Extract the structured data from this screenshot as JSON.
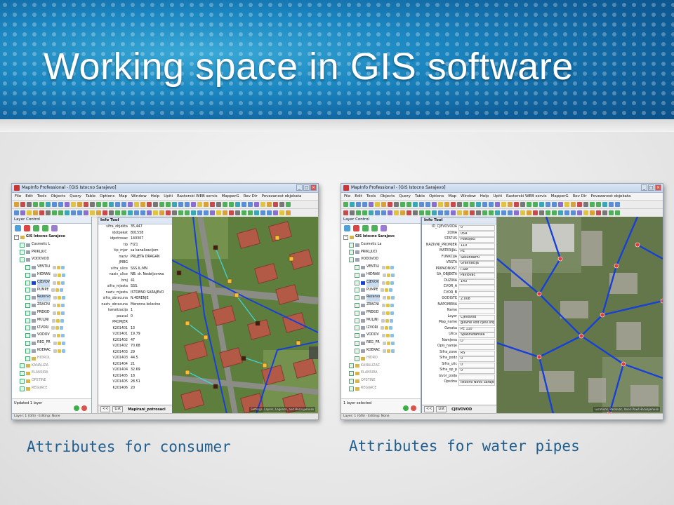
{
  "slide": {
    "title": "Working space in GIS software",
    "captions": {
      "left": "Attributes for consumer",
      "right": "Attributes for water pipes"
    }
  },
  "app": {
    "window_title": "MapInfo Professional - [GIS Istocno Sarajevo]",
    "menus": [
      "File",
      "Edit",
      "Tools",
      "Objects",
      "Query",
      "Table",
      "Options",
      "Map",
      "Window",
      "Help",
      "Upiti",
      "Rasterski WEB servis",
      "MapperG",
      "Rev Dir",
      "Povezanost objekata"
    ]
  },
  "layer_control": {
    "title": "Layer Control",
    "root": "GIS Istocno Sarajevo",
    "layers_left": [
      "Cosmetic L",
      "PRIKLJUC",
      "VODOVOD",
      "VENTILI",
      "HIDRAN",
      "CJEVOV",
      "PUMPE",
      "Rezervo",
      "ZRACNI",
      "PREKID",
      "MULJNI",
      "IZVORI",
      "VODOV",
      "REG_PR",
      "KOERAC",
      "HIDROL",
      "KANALIZA",
      "ELANSIRA",
      "OPSTINE",
      "REGIJACE"
    ],
    "layers_right": [
      "Cosmetic La",
      "PRIKLJUCI",
      "VODOVOD",
      "VENTILI",
      "HIDRAN",
      "CJEVOV",
      "PUMPE",
      "Rezervo",
      "ZRACNI",
      "PREKID",
      "MULJNI",
      "IZVORI",
      "VODOV",
      "REG_PR",
      "KOERAC",
      "HIDRO",
      "KANALIZAC",
      "ELANSIRA",
      "OPSTINE",
      "REGIJACE"
    ],
    "status_left": "Updated 1 layer",
    "status_right": "1 layer selected"
  },
  "info_left": {
    "title": "Info Tool",
    "rows": [
      {
        "k": "sifra_objekta",
        "v": "35,447"
      },
      {
        "k": "idobjekat",
        "v": "801558"
      },
      {
        "k": "idpotrosac",
        "v": "140307"
      },
      {
        "k": "tip",
        "v": "FIZ1"
      },
      {
        "k": "tip_mjer",
        "v": "sa kanalizacijom"
      },
      {
        "k": "naziv",
        "v": "PRLJETA DRAGAN"
      },
      {
        "k": "JMBG",
        "v": ""
      },
      {
        "k": "sifra_ulice",
        "v": "SSS.IL.MN"
      },
      {
        "k": "naziv_ulice",
        "v": "NB. dr. Nedeljovrwa"
      },
      {
        "k": "broj",
        "v": "41"
      },
      {
        "k": "sifra_mjesta",
        "v": "SSS."
      },
      {
        "k": "naziv_mjesta",
        "v": "ISTOENO SARAJEVO"
      },
      {
        "k": "sifra_obracuna",
        "v": "N.4ERENJE"
      },
      {
        "k": "naziv_obracuna",
        "v": "Merenna kolecine"
      },
      {
        "k": "kanalizacija",
        "v": "1"
      },
      {
        "k": "pausal",
        "v": "0"
      },
      {
        "k": "PROMJER",
        "v": ""
      },
      {
        "k": "K201401",
        "v": "13"
      },
      {
        "k": "V201401",
        "v": "19.79"
      },
      {
        "k": "K201402",
        "v": "47"
      },
      {
        "k": "V201402",
        "v": "70.68"
      },
      {
        "k": "K201403",
        "v": "29"
      },
      {
        "k": "V201403",
        "v": "44.5"
      },
      {
        "k": "K201404",
        "v": "21"
      },
      {
        "k": "V201404",
        "v": "32.69"
      },
      {
        "k": "K201405",
        "v": "18"
      },
      {
        "k": "V201405",
        "v": "28.51"
      },
      {
        "k": "K201406",
        "v": "20"
      }
    ],
    "footer_table": "Mapirani_potrosaci",
    "footer_prev": "<<",
    "footer_list": "List"
  },
  "info_right": {
    "title": "Info Tool",
    "rows": [
      {
        "k": "ID_CJEVOVODA",
        "v": "0"
      },
      {
        "k": "ZONA",
        "v": "05A"
      },
      {
        "k": "STATUS",
        "v": "Postojeci"
      },
      {
        "k": "NAZIVNI_PROMJER",
        "v": "110"
      },
      {
        "k": "MATERIJAL",
        "v": "PE"
      },
      {
        "k": "FUNKCIJA",
        "v": "Sekundarni"
      },
      {
        "k": "VRSTA",
        "v": "Gravitacija"
      },
      {
        "k": "PRIPADNOST",
        "v": "I.Sar"
      },
      {
        "k": "SA_OBJEKTA",
        "v": "Pavlovac"
      },
      {
        "k": "DUZINA",
        "v": "143"
      },
      {
        "k": "CVOR_A",
        "v": ""
      },
      {
        "k": "CVOR_B",
        "v": ""
      },
      {
        "k": "GODISTE",
        "v": "2,008"
      },
      {
        "k": "NAPOMENA",
        "v": ""
      },
      {
        "k": "Name",
        "v": ""
      },
      {
        "k": "Layer",
        "v": "Cjevovod"
      },
      {
        "k": "Map_name",
        "v": "glavne vod cjevi.shp"
      },
      {
        "k": "Oznaka",
        "v": "PE 110"
      },
      {
        "k": "Ulica",
        "v": "Spasovdanska"
      },
      {
        "k": "Namjena",
        "v": "D"
      },
      {
        "k": "Opis_namje",
        "v": ""
      },
      {
        "k": "Sifra_zone",
        "v": "RS"
      },
      {
        "k": "Sifra_podz",
        "v": "0"
      },
      {
        "k": "Sifra_ulic",
        "v": "0"
      },
      {
        "k": "Sifra_op_p",
        "v": "0"
      },
      {
        "k": "Izvor_poda",
        "v": ""
      },
      {
        "k": "Opstina",
        "v": "Istocno Novo Sarajevo"
      }
    ],
    "footer_table": "CJEVOVOD",
    "footer_prev": "<<",
    "footer_list": "List"
  },
  "map": {
    "caption_left": "Settings: Layers, Legends, and Hocuspenuse",
    "caption_right": "Locations, Pavlovac, Izvori Pawl Hocuspenuse"
  },
  "colors": {
    "title_text": "#ffffff",
    "caption_text": "#1f5e8f",
    "pipe_blue": "#1740d8",
    "consumer_marker": "#f2c23a"
  }
}
